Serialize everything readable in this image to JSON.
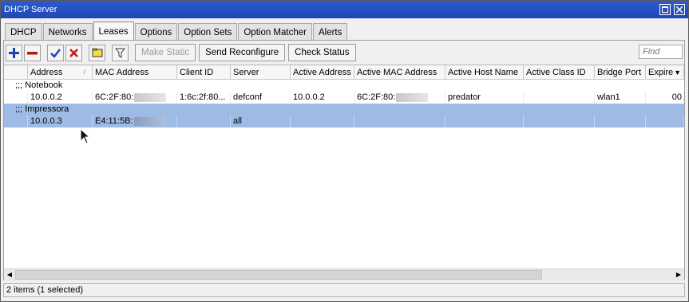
{
  "window": {
    "title": "DHCP Server"
  },
  "tabs": [
    {
      "label": "DHCP"
    },
    {
      "label": "Networks"
    },
    {
      "label": "Leases"
    },
    {
      "label": "Options"
    },
    {
      "label": "Option Sets"
    },
    {
      "label": "Option Matcher"
    },
    {
      "label": "Alerts"
    }
  ],
  "toolbar": {
    "make_static": "Make Static",
    "send_reconfigure": "Send Reconfigure",
    "check_status": "Check Status",
    "find_placeholder": "Find"
  },
  "columns": [
    {
      "label": "Address"
    },
    {
      "label": "MAC Address"
    },
    {
      "label": "Client ID"
    },
    {
      "label": "Server"
    },
    {
      "label": "Active Address"
    },
    {
      "label": "Active MAC Address"
    },
    {
      "label": "Active Host Name"
    },
    {
      "label": "Active Class ID"
    },
    {
      "label": "Bridge Port"
    },
    {
      "label": "Expire"
    }
  ],
  "rows": [
    {
      "comment": ";;; Notebook",
      "address": "10.0.0.2",
      "mac": "6C:2F:80:",
      "client_id": "1:6c:2f:80...",
      "server": "defconf",
      "active_address": "10.0.0.2",
      "active_mac": "6C:2F:80:",
      "active_host": "predator",
      "active_class": "",
      "bridge_port": "wlan1",
      "expire": "00"
    },
    {
      "comment": ";;; Impressora",
      "address": "10.0.0.3",
      "mac": "E4:11:5B:",
      "client_id": "",
      "server": "all",
      "active_address": "",
      "active_mac": "",
      "active_host": "",
      "active_class": "",
      "bridge_port": "",
      "expire": ""
    }
  ],
  "status": "2 items (1 selected)",
  "colors": {
    "titlebar": "#2a52be",
    "selection": "#9ebbe6"
  }
}
